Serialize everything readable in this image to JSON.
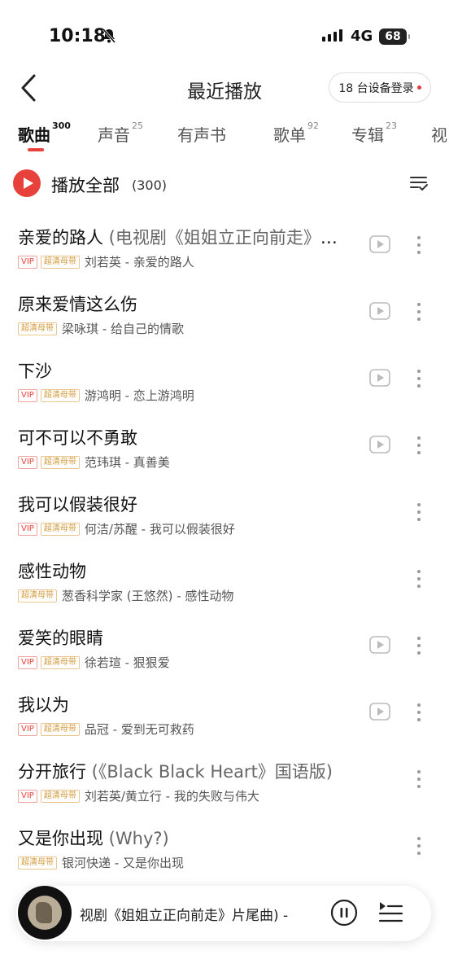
{
  "status": {
    "time": "10:18",
    "network": "4G",
    "battery": "68"
  },
  "nav": {
    "title": "最近播放",
    "device_login": "18 台设备登录"
  },
  "tabs": [
    {
      "label": "歌曲",
      "count": "300"
    },
    {
      "label": "声音",
      "count": "25"
    },
    {
      "label": "有声书",
      "count": ""
    },
    {
      "label": "歌单",
      "count": "92"
    },
    {
      "label": "专辑",
      "count": "23"
    },
    {
      "label": "视",
      "count": ""
    }
  ],
  "play_all": {
    "label": "播放全部",
    "count": "(300)"
  },
  "songs": [
    {
      "title": "亲爱的路人",
      "extra": " (电视剧《姐姐立正向前走》片尾曲)",
      "vip": "VIP",
      "hq": "超清母带",
      "artist": "刘若英 - 亲爱的路人",
      "mv": true
    },
    {
      "title": "原来爱情这么伤",
      "extra": "",
      "vip": "",
      "hq": "超清母带",
      "artist": "梁咏琪 - 给自己的情歌",
      "mv": true
    },
    {
      "title": "下沙",
      "extra": "",
      "vip": "VIP",
      "hq": "超清母带",
      "artist": "游鸿明 - 恋上游鸿明",
      "mv": true
    },
    {
      "title": "可不可以不勇敢",
      "extra": "",
      "vip": "VIP",
      "hq": "超清母带",
      "artist": "范玮琪 - 真善美",
      "mv": true
    },
    {
      "title": "我可以假装很好",
      "extra": "",
      "vip": "VIP",
      "hq": "超清母带",
      "artist": "何洁/苏醒 - 我可以假装很好",
      "mv": false
    },
    {
      "title": "感性动物",
      "extra": "",
      "vip": "",
      "hq": "超清母带",
      "artist": "葱香科学家 (王悠然) - 感性动物",
      "mv": false
    },
    {
      "title": "爱笑的眼睛",
      "extra": "",
      "vip": "VIP",
      "hq": "超清母带",
      "artist": "徐若瑄 - 狠狠爱",
      "mv": true
    },
    {
      "title": "我以为",
      "extra": "",
      "vip": "VIP",
      "hq": "超清母带",
      "artist": "品冠 - 爱到无可救药",
      "mv": true
    },
    {
      "title": "分开旅行",
      "extra": " (《Black Black Heart》国语版)",
      "vip": "VIP",
      "hq": "超清母带",
      "artist": "刘若英/黄立行 - 我的失败与伟大",
      "mv": false
    },
    {
      "title": "又是你出现",
      "extra": " (Why?)",
      "vip": "",
      "hq": "超清母带",
      "artist": "银河快递 - 又是你出现",
      "mv": false
    }
  ],
  "player": {
    "now_playing": "视剧《姐姐立正向前走》片尾曲) - "
  },
  "colors": {
    "accent": "#e8413c",
    "hq_tag": "#d39a3c"
  }
}
